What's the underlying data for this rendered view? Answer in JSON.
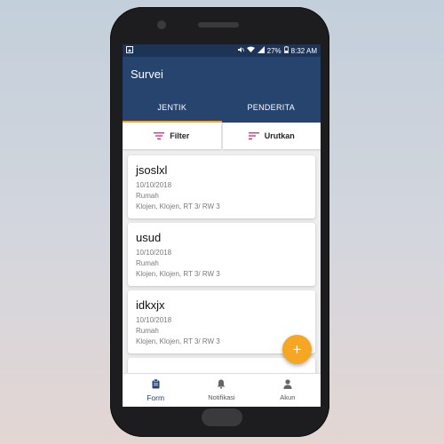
{
  "status_bar": {
    "battery": "27%",
    "time": "8:32 AM"
  },
  "app_bar": {
    "title": "Survei"
  },
  "tabs": [
    {
      "label": "JENTIK",
      "active": true
    },
    {
      "label": "PENDERITA",
      "active": false
    }
  ],
  "filter_bar": {
    "filter_label": "Filter",
    "sort_label": "Urutkan"
  },
  "cards": [
    {
      "name": "jsoslxl",
      "date": "10/10/2018",
      "type": "Rumah",
      "address": "Klojen, Klojen, RT 3/ RW 3"
    },
    {
      "name": "usud",
      "date": "10/10/2018",
      "type": "Rumah",
      "address": "Klojen, Klojen, RT 3/ RW 3"
    },
    {
      "name": "idkxjx",
      "date": "10/10/2018",
      "type": "Rumah",
      "address": "Klojen, Klojen, RT 3/ RW 3"
    }
  ],
  "fab": {
    "label": "+"
  },
  "bottom_nav": [
    {
      "label": "Form",
      "icon": "clipboard-icon",
      "active": true
    },
    {
      "label": "Notifikasi",
      "icon": "bell-icon",
      "active": false
    },
    {
      "label": "Akun",
      "icon": "person-icon",
      "active": false
    }
  ],
  "colors": {
    "primary": "#27446e",
    "accent": "#f5a623",
    "filter_icon": "#d63384"
  }
}
